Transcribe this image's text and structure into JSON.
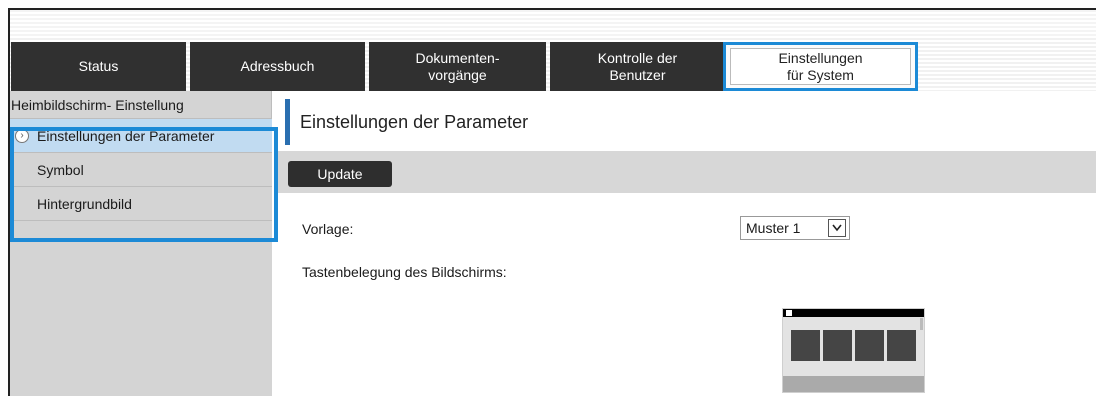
{
  "tabs": [
    {
      "label": "Status",
      "active": false
    },
    {
      "label": "Adressbuch",
      "active": false
    },
    {
      "label": "Dokumenten-\nvorgänge",
      "active": false
    },
    {
      "label": "Kontrolle der\nBenutzer",
      "active": false
    },
    {
      "label": "Einstellungen\nfür System",
      "active": true
    }
  ],
  "sidebar": {
    "title": "Heimbildschirm- Einstellung",
    "items": [
      {
        "label": "Einstellungen der Parameter",
        "active": true
      },
      {
        "label": "Symbol",
        "active": false
      },
      {
        "label": "Hintergrundbild",
        "active": false
      }
    ]
  },
  "main": {
    "title": "Einstellungen der Parameter",
    "update_label": "Update",
    "vorlage_label": "Vorlage:",
    "vorlage_value": "Muster 1",
    "tastenbelegung_label": "Tastenbelegung des Bildschirms:"
  },
  "colors": {
    "highlight": "#1c8ad6",
    "tab_dark": "#303030",
    "active_item": "#c1dbf1"
  }
}
